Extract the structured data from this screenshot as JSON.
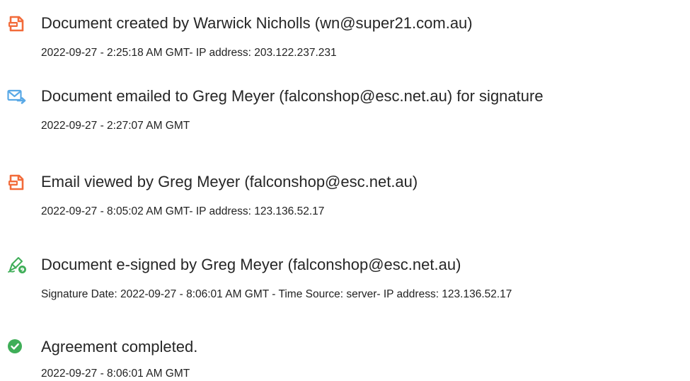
{
  "events": [
    {
      "icon": "document-created-icon",
      "title": "Document created by Warwick Nicholls (wn@super21.com.au)",
      "detail": "2022-09-27 - 2:25:18 AM GMT- IP address: 203.122.237.231"
    },
    {
      "icon": "email-sent-icon",
      "title": "Document emailed to Greg Meyer (falconshop@esc.net.au) for signature",
      "detail": "2022-09-27 - 2:27:07 AM GMT"
    },
    {
      "icon": "email-viewed-icon",
      "title": "Email viewed by Greg Meyer (falconshop@esc.net.au)",
      "detail": "2022-09-27 - 8:05:02 AM GMT- IP address: 123.136.52.17"
    },
    {
      "icon": "e-sign-pen-icon",
      "title": "Document e-signed by Greg Meyer (falconshop@esc.net.au)",
      "detail": "Signature Date: 2022-09-27 - 8:06:01 AM GMT - Time Source: server- IP address: 123.136.52.17"
    },
    {
      "icon": "check-circle-icon",
      "title": "Agreement completed.",
      "detail": "2022-09-27 - 8:06:01 AM GMT"
    }
  ],
  "colors": {
    "orange_accent": "#F26B3A",
    "blue_accent": "#5AA9E6",
    "green_accent": "#3FAE58",
    "title_text": "#262626",
    "detail_text": "#222222"
  }
}
